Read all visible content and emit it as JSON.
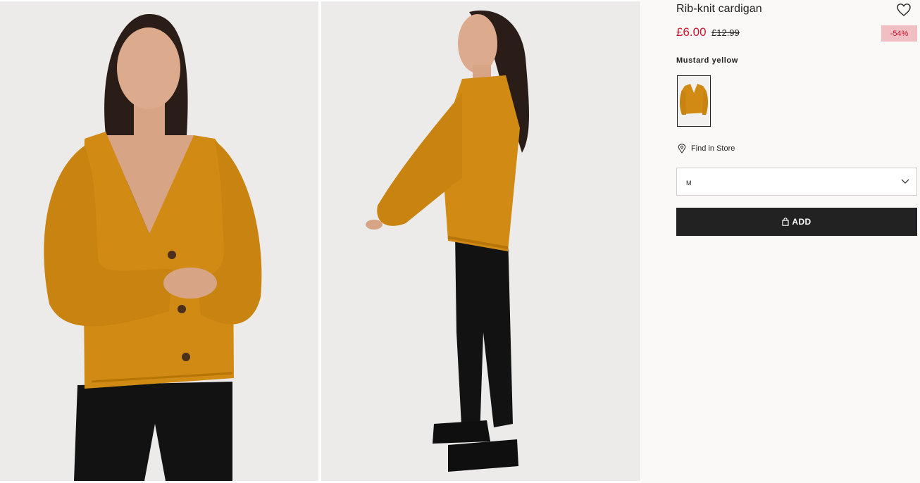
{
  "product": {
    "title": "Rib-knit cardigan",
    "price_current": "£6.00",
    "price_original": "£12.99",
    "discount_badge": "-54%"
  },
  "color": {
    "label": "Mustard yellow",
    "swatch_hex": "#d18a14"
  },
  "store": {
    "find_in_store_label": "Find in Store",
    "icon": "location-pin-icon"
  },
  "size": {
    "selected": "M",
    "icon": "chevron-down-icon"
  },
  "cart": {
    "add_label": "ADD",
    "icon": "shopping-bag-icon"
  },
  "favorite": {
    "icon": "heart-icon"
  },
  "theme": {
    "sale_red": "#c7152b",
    "badge_bg": "#f0bec3",
    "button_bg": "#222222",
    "panel_bg": "#faf9f8",
    "photo_bg": "#ecebe9"
  }
}
